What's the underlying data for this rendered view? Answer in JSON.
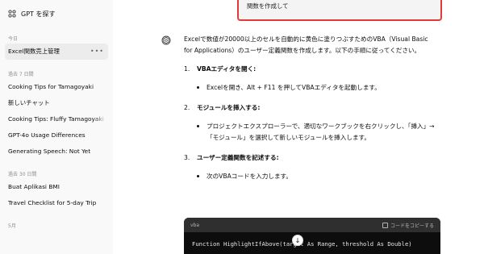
{
  "sidebar": {
    "gpt_search": "GPT を探す",
    "sections": [
      {
        "label": "今日",
        "items": [
          {
            "label": "Excel関数売上管理",
            "active": true
          }
        ]
      },
      {
        "label": "過去 7 日間",
        "items": [
          {
            "label": "Cooking Tips for Tamagoyaki"
          },
          {
            "label": "新しいチャット"
          },
          {
            "label": "Cooking Tips: Fluffy Tamagoyaki"
          },
          {
            "label": "GPT-4o Usage Differences"
          },
          {
            "label": "Generating Speech: Not Yet"
          }
        ]
      },
      {
        "label": "過去 30 日間",
        "items": [
          {
            "label": "Buat Aplikasi BMI"
          },
          {
            "label": "Travel Checklist for 5-day Trip"
          }
        ]
      },
      {
        "label": "5月",
        "items": []
      }
    ]
  },
  "user_message": {
    "visible_text": "関数を作成して"
  },
  "assistant": {
    "intro": "Excelで数値が20000以上のセルを自動的に黄色に塗りつぶすためのVBA（Visual Basic for Applications）のユーザー定義関数を作成します。以下の手順に従ってください。",
    "steps": [
      {
        "num": "1.",
        "title": "VBAエディタを開く:",
        "bullet": "Excelを開き、Alt + F11 を押してVBAエディタを起動します。"
      },
      {
        "num": "2.",
        "title": "モジュールを挿入する:",
        "bullet": "プロジェクトエクスプローラーで、適切なワークブックを右クリックし、「挿入」→「モジュール」を選択して新しいモジュールを挿入します。"
      },
      {
        "num": "3.",
        "title": "ユーザー定義関数を記述する:",
        "bullet": "次のVBAコードを入力します。"
      }
    ],
    "code": {
      "language": "vba",
      "copy_label": "コードをコピーする",
      "first_line": "Function HighlightIfAbove(target As Range, threshold As Double)"
    }
  },
  "colors": {
    "highlight_border": "#e53935",
    "sidebar_bg": "#f9f9f9",
    "active_item_bg": "#ececec",
    "code_bg": "#0d0d0d"
  },
  "icons": {
    "gpt_search": "grid-icon",
    "assistant": "openai-logo-icon",
    "item_menu": "ellipsis-icon",
    "copy": "copy-icon",
    "scroll": "arrow-down-icon"
  }
}
